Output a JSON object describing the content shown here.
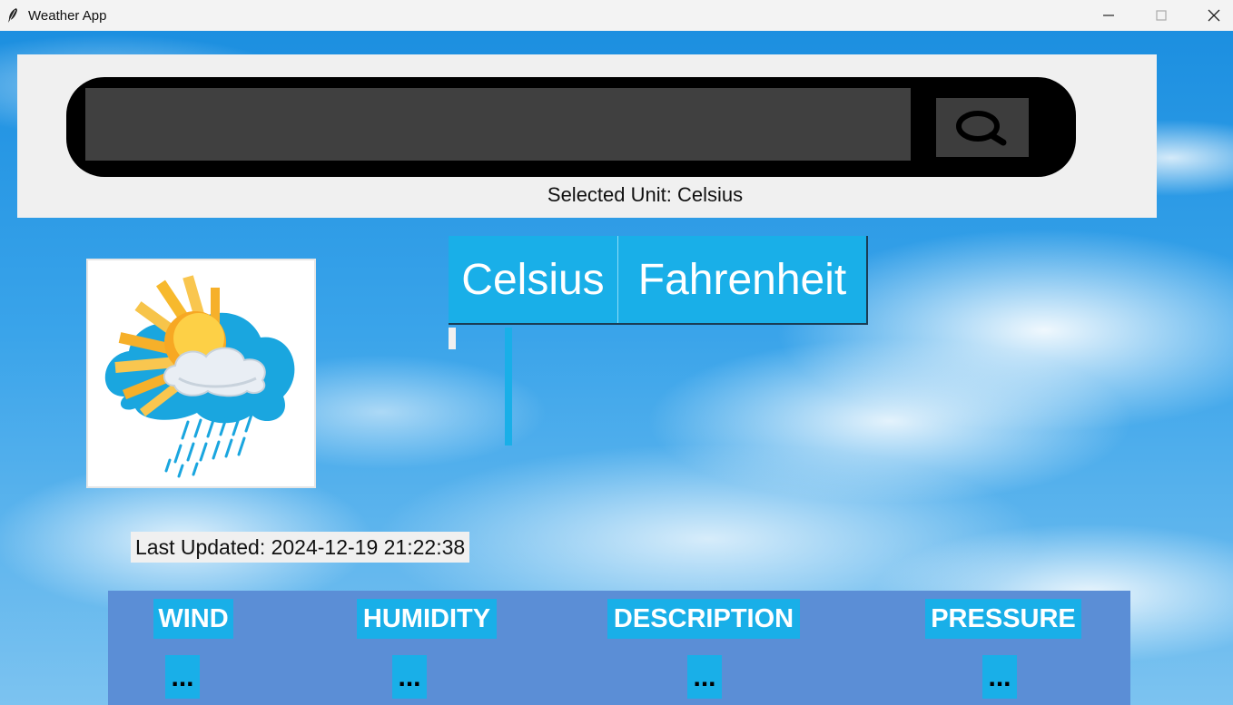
{
  "window": {
    "title": "Weather App",
    "controls": [
      "minimize",
      "maximize",
      "close"
    ]
  },
  "search": {
    "value": "",
    "button_icon": "search-icon"
  },
  "unit": {
    "status": "Selected Unit: Celsius",
    "options": [
      "Celsius",
      "Fahrenheit"
    ]
  },
  "weather_icon": "sun-cloud-rain-icon",
  "last_updated": "Last Updated: 2024-12-19 21:22:38",
  "stats": [
    {
      "label": "WIND",
      "value": "..."
    },
    {
      "label": "HUMIDITY",
      "value": "..."
    },
    {
      "label": "DESCRIPTION",
      "value": "..."
    },
    {
      "label": "PRESSURE",
      "value": "..."
    }
  ],
  "colors": {
    "accent": "#19afe8",
    "info_bar": "#5b8ed6",
    "search_bg": "#000000",
    "input_bg": "#404040"
  }
}
